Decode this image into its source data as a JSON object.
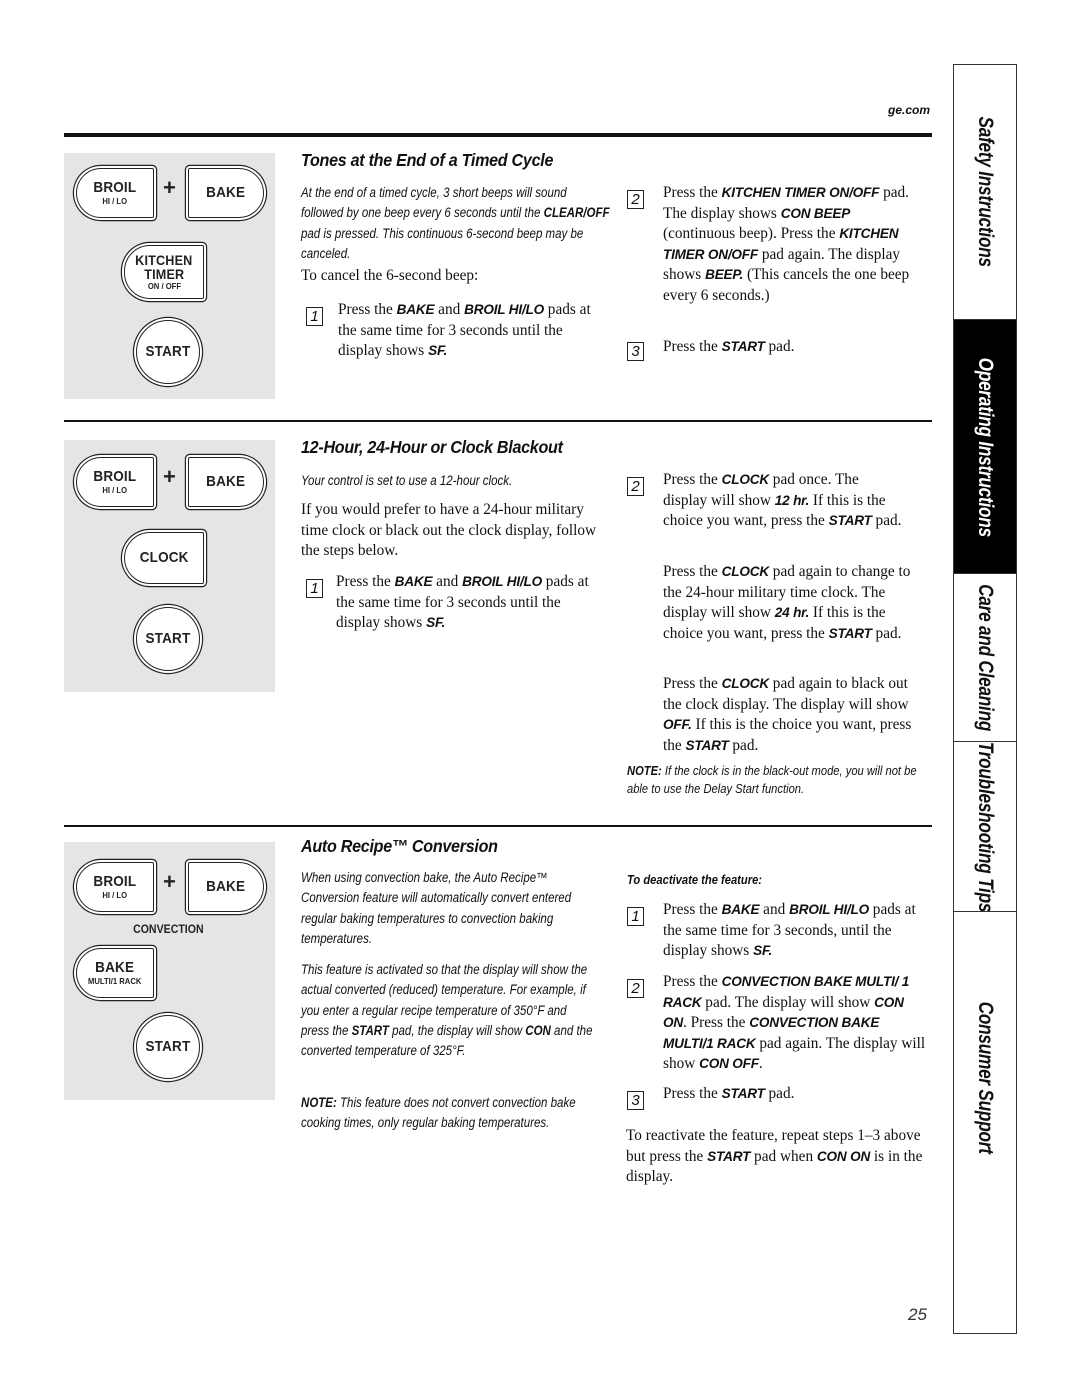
{
  "header": {
    "site": "ge.com"
  },
  "page_number": "25",
  "side_tabs": [
    {
      "label": "Safety Instructions",
      "active": false
    },
    {
      "label": "Operating Instructions",
      "active": true
    },
    {
      "label": "Care and Cleaning",
      "active": false
    },
    {
      "label": "Troubleshooting Tips",
      "active": false
    },
    {
      "label": "Consumer Support",
      "active": false
    }
  ],
  "sections": [
    {
      "title": "Tones at the End of a Timed Cycle",
      "pads": {
        "broil": {
          "main": "BROIL",
          "sub": "HI / LO"
        },
        "plus": "+",
        "bake": {
          "main": "BAKE"
        },
        "kitchen_timer": {
          "line1": "KITCHEN",
          "line2": "TIMER",
          "sub": "ON / OFF"
        },
        "start": {
          "main": "START"
        }
      },
      "intro": [
        "At the end of a timed cycle, 3 short beeps will sound followed by one beep every 6 seconds until the ",
        "CLEAR/OFF",
        " pad is pressed. This continuous 6-second beep may be canceled."
      ],
      "lead": "To cancel the 6-second beep:",
      "steps": [
        {
          "num": "1",
          "parts": [
            "Press the ",
            "BAKE",
            " and ",
            "BROIL HI/LO",
            " pads at the same time for 3 seconds until the display shows ",
            "SF."
          ]
        },
        {
          "num": "2",
          "parts": [
            "Press the ",
            "KITCHEN TIMER ON/OFF",
            " pad. The display shows ",
            "CON BEEP",
            " (continuous beep). Press the ",
            "KITCHEN TIMER ON/OFF",
            " pad again. The display shows ",
            "BEEP.",
            " (This cancels the one beep every 6 seconds.)"
          ]
        },
        {
          "num": "3",
          "parts": [
            "Press the ",
            "START",
            " pad."
          ]
        }
      ]
    },
    {
      "title": "12-Hour, 24-Hour or Clock Blackout",
      "pads": {
        "broil": {
          "main": "BROIL",
          "sub": "HI / LO"
        },
        "plus": "+",
        "bake": {
          "main": "BAKE"
        },
        "clock": {
          "main": "CLOCK"
        },
        "start": {
          "main": "START"
        }
      },
      "intro": "Your control is set to use a 12-hour clock.",
      "lead": "If you would prefer to have a 24-hour military time clock or black out the clock display, follow the steps below.",
      "steps": [
        {
          "num": "1",
          "parts": [
            "Press the ",
            "BAKE",
            " and ",
            "BROIL HI/LO",
            " pads at the same time for 3 seconds until the display shows ",
            "SF."
          ]
        },
        {
          "num": "2",
          "parts": [
            "Press the ",
            "CLOCK",
            " pad once. The display will show ",
            "12 hr.",
            " If this is the choice you want, press the ",
            "START",
            " pad."
          ]
        }
      ],
      "paragraphs": [
        [
          "Press the ",
          "CLOCK",
          " pad again to change to the 24-hour military time clock. The display will show ",
          "24 hr.",
          " If this is the choice you want, press the ",
          "START",
          " pad."
        ],
        [
          "Press the ",
          "CLOCK",
          " pad again to black out the clock display. The display will show ",
          "OFF.",
          " If this is the choice you want, press the ",
          "START",
          " pad."
        ]
      ],
      "note": {
        "label": "NOTE:",
        "text": " If the clock is in the black-out mode, you will not be able to use the Delay Start function."
      }
    },
    {
      "title": "Auto Recipe™ Conversion",
      "pads": {
        "broil": {
          "main": "BROIL",
          "sub": "HI / LO"
        },
        "plus": "+",
        "bake": {
          "main": "BAKE"
        },
        "convection_label": "CONVECTION",
        "conv_bake": {
          "main": "BAKE",
          "sub": "MULTI/1 RACK"
        },
        "start": {
          "main": "START"
        }
      },
      "intro": "When using convection bake, the Auto Recipe™ Conversion feature will automatically convert entered regular baking temperatures to convection baking temperatures.",
      "activated": [
        "This feature is activated so that the display will show the actual converted (reduced) temperature. For example, if you enter a regular recipe temperature of 350°F and press the ",
        "START",
        " pad, the display will show ",
        "CON",
        " and the converted temperature of 325°F."
      ],
      "note": {
        "label": "NOTE:",
        "text": " This feature does not convert convection bake cooking times, only regular baking temperatures."
      },
      "deactivate_heading": "To deactivate the feature:",
      "steps": [
        {
          "num": "1",
          "parts": [
            "Press the ",
            "BAKE",
            " and ",
            "BROIL HI/LO",
            " pads at the same time for 3 seconds, until the display shows ",
            "SF."
          ]
        },
        {
          "num": "2",
          "parts": [
            "Press the ",
            "CONVECTION BAKE MULTI/ 1 RACK",
            " pad. The display will show ",
            "CON ON",
            ". Press the ",
            "CONVECTION BAKE MULTI/1 RACK",
            " pad again. The display will show ",
            "CON OFF",
            "."
          ]
        },
        {
          "num": "3",
          "parts": [
            "Press the ",
            "START",
            " pad."
          ]
        }
      ],
      "reactivate": [
        "To reactivate the feature, repeat steps 1–3 above but press the ",
        "START",
        " pad when ",
        "CON ON",
        " is in the display."
      ]
    }
  ]
}
